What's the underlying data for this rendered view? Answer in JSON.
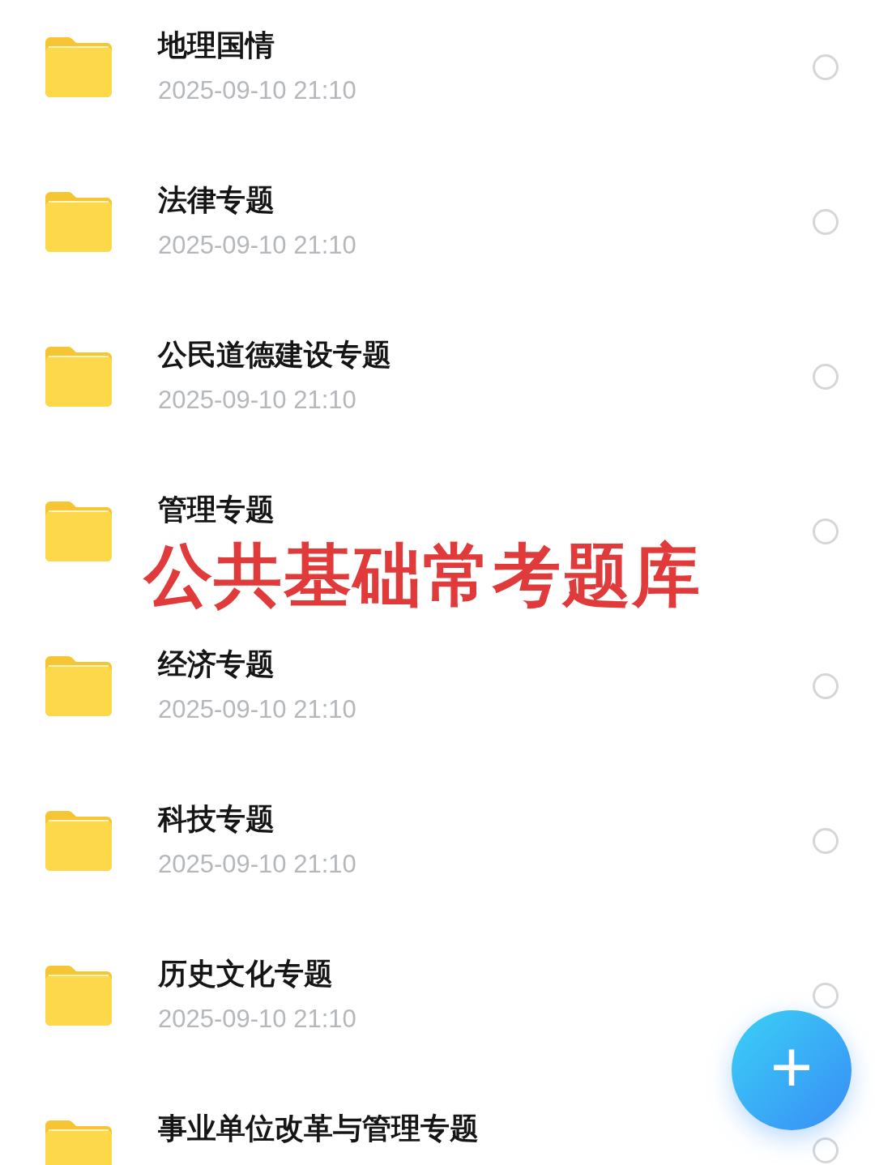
{
  "items": [
    {
      "name": "地理国情",
      "date": "2025-09-10 21:10",
      "selected": false
    },
    {
      "name": "法律专题",
      "date": "2025-09-10 21:10",
      "selected": false
    },
    {
      "name": "公民道德建设专题",
      "date": "2025-09-10 21:10",
      "selected": false
    },
    {
      "name": "管理专题",
      "selected": false
    },
    {
      "name": "经济专题",
      "date": "2025-09-10 21:10",
      "selected": false
    },
    {
      "name": "科技专题",
      "date": "2025-09-10 21:10",
      "selected": false
    },
    {
      "name": "历史文化专题",
      "date": "2025-09-10 21:10",
      "selected": false
    },
    {
      "name": "事业单位改革与管理专题",
      "selected": false
    }
  ],
  "overlay_caption": "公共基础常考题库",
  "add_button": {
    "label": "+"
  }
}
